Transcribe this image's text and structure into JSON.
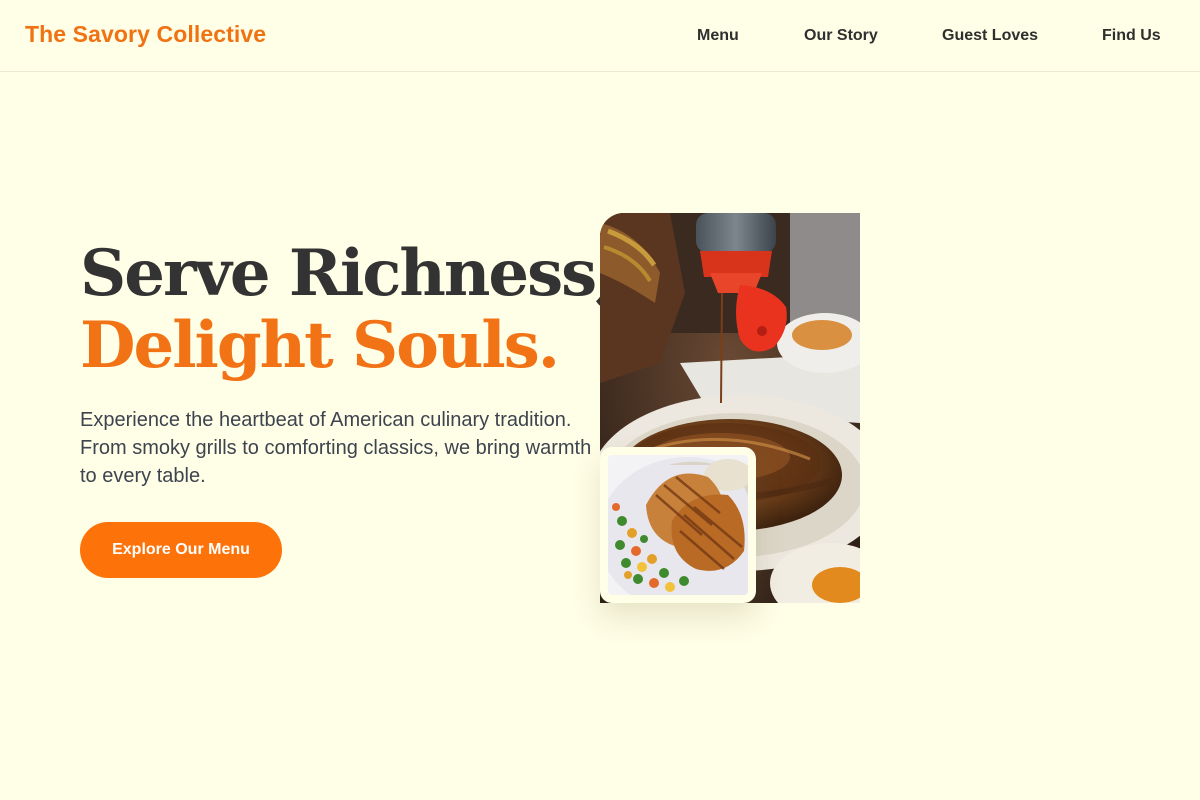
{
  "header": {
    "brand": "The Savory Collective",
    "nav": [
      {
        "label": "Menu"
      },
      {
        "label": "Our Story"
      },
      {
        "label": "Guest Loves"
      },
      {
        "label": "Find Us"
      }
    ]
  },
  "hero": {
    "title_line1": "Serve Richness,",
    "title_line2": "Delight Souls.",
    "description": "Experience the heartbeat of American culinary tradition. From smoky grills to comforting classics, we bring warmth to every table.",
    "cta_label": "Explore Our Menu"
  },
  "images": {
    "main": "pancakes-with-syrup-photo",
    "secondary": "grilled-chicken-with-vegetables-photo"
  },
  "colors": {
    "background": "#fffee6",
    "accent": "#f27316",
    "cta": "#fd7209",
    "heading": "#333333",
    "body_text": "#3d4450"
  }
}
